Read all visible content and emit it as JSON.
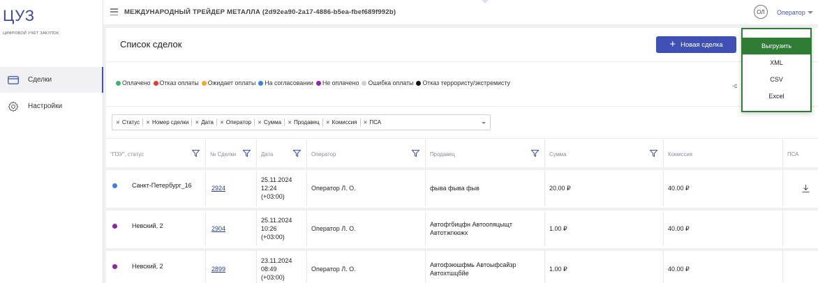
{
  "app": {
    "logo": "ЦУЗ",
    "tagline": "цифровой учёт закупок",
    "company": "МЕЖДУНАРОДНЫЙ ТРЕЙДЕР МЕТАЛЛА (2d92ea90-2a17-4886-b5ea-fbef689f992b)"
  },
  "sidebar": {
    "items": [
      {
        "label": "Сделки",
        "icon": "deals-card-icon",
        "active": true
      },
      {
        "label": "Настройки",
        "icon": "gear-icon",
        "active": false
      }
    ]
  },
  "user": {
    "initials": "ОЛ",
    "role": "Оператор"
  },
  "page": {
    "title": "Список сделок",
    "new_button": "Новая сделка",
    "new_button_icon": "+"
  },
  "legend": [
    {
      "label": "Оплачено",
      "color": "#3cb371"
    },
    {
      "label": "Отказ оплаты",
      "color": "#e53935"
    },
    {
      "label": "Ожидает оплаты",
      "color": "#f5a623"
    },
    {
      "label": "На согласовании",
      "color": "#3f7fe0"
    },
    {
      "label": "Не оплачено",
      "color": "#8e24aa"
    },
    {
      "label": "Ошибка оплаты",
      "color": "#cfcfcf"
    },
    {
      "label": "Отказ террористу/экстремисту",
      "color": "#111111"
    }
  ],
  "legend_tail": "-с",
  "columns_filter": {
    "chips": [
      "Статус",
      "Номер сделки",
      "Дата",
      "Оператор",
      "Сумма",
      "Продавец",
      "Комиссия",
      "ПСА"
    ]
  },
  "table": {
    "headers": [
      "\"ПЗУ\", статус",
      "№ Сделки",
      "Дата",
      "Оператор",
      "Продавец",
      "Сумма",
      "Комиссия",
      "ПСА"
    ],
    "rows": [
      {
        "status_color": "#3f7fe0",
        "address": "Санкт-Петербург_16",
        "deal": "2924",
        "date1": "25.11.2024",
        "date2": "12:24",
        "date3": "(+03:00)",
        "operator": "Оператор Л. О.",
        "seller1": "фыва фыва фыв",
        "seller2": "",
        "sum": "20.00 ₽",
        "commission": "40.00 ₽",
        "psa_download": true
      },
      {
        "status_color": "#8e24aa",
        "address": "Невский, 2",
        "deal": "2904",
        "date1": "25.11.2024",
        "date2": "10:26",
        "date3": "(+03:00)",
        "operator": "Оператор Л. О.",
        "seller1": "Автофгбицфн Автоопяцыщт",
        "seller2": "Автотжгкюжх",
        "sum": "1.00 ₽",
        "commission": "40.00 ₽",
        "psa_download": false
      },
      {
        "status_color": "#8e24aa",
        "address": "Невский, 2",
        "deal": "2899",
        "date1": "23.11.2024",
        "date2": "08:49",
        "date3": "(+03:00)",
        "operator": "Оператор Л. О.",
        "seller1": "Автофэюшфмь Автоыфсайзр",
        "seller2": "Автохтшцбйе",
        "sum": "1.00 ₽",
        "commission": "40.00 ₽",
        "psa_download": false
      }
    ]
  },
  "export_menu": {
    "title": "Выгрузить",
    "options": [
      "XML",
      "CSV",
      "Excel"
    ],
    "border_color": "#2e7d32"
  }
}
